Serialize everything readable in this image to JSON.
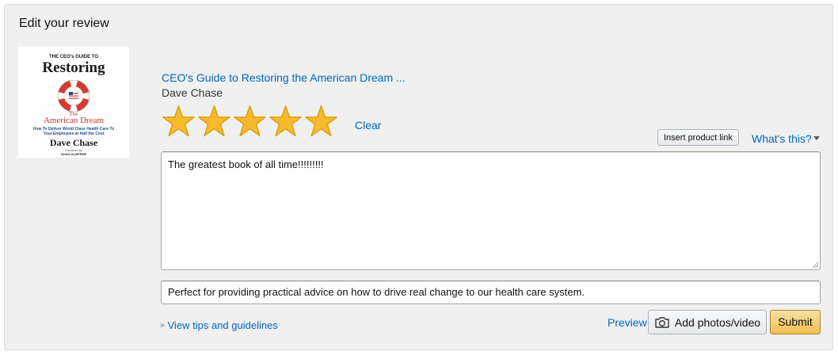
{
  "header": {
    "title": "Edit your review"
  },
  "product": {
    "title_link": "CEO's Guide to Restoring the American Dream ...",
    "author": "Dave Chase",
    "cover": {
      "top_line": "THE CEO's GUIDE TO",
      "main_title": "Restoring",
      "the": "The",
      "dream": "American Dream",
      "tagline": "How To Deliver World Class Health Care To Your Employees at Half the Cost",
      "author": "Dave Chase",
      "foreword_label": "Foreword by",
      "foreword_author": "SOGO KLEPPER"
    }
  },
  "rating": {
    "value": 5,
    "max": 5,
    "clear_label": "Clear",
    "star_color": "#f8b92b"
  },
  "toolbar": {
    "insert_product_link": "Insert product link",
    "whats_this": "What's this?"
  },
  "review": {
    "body": "The greatest book of all time!!!!!!!!!"
  },
  "headline": {
    "value": "Perfect for providing practical advice on how to drive real change to our health care system."
  },
  "footer": {
    "tips_label": "View tips and guidelines",
    "preview_label": "Preview",
    "add_media_label": "Add photos/video",
    "submit_label": "Submit"
  },
  "colors": {
    "link": "#0066c0",
    "submit": "#f0c14b",
    "panel": "#f0f0f0"
  }
}
